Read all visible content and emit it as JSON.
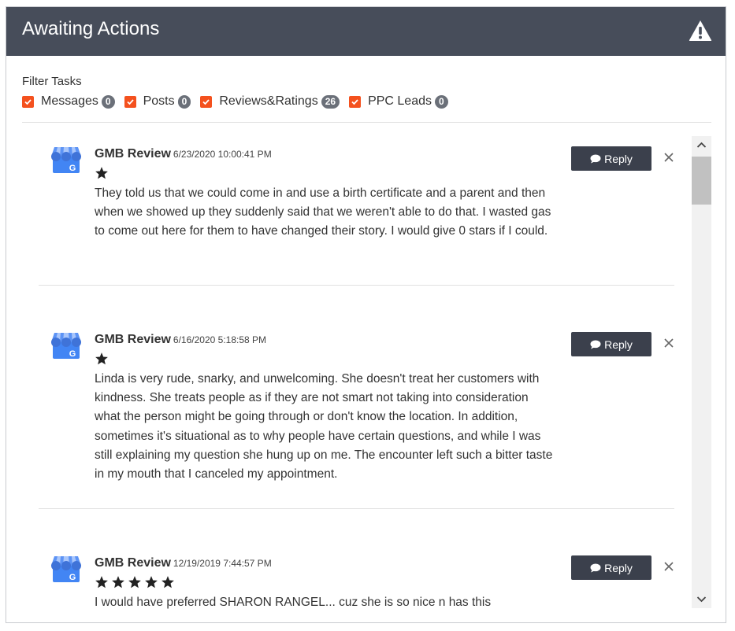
{
  "header": {
    "title": "Awaiting Actions",
    "icon": "warning-icon"
  },
  "filter": {
    "label": "Filter Tasks",
    "items": [
      {
        "label": "Messages",
        "count": "0",
        "checked": true
      },
      {
        "label": "Posts",
        "count": "0",
        "checked": true
      },
      {
        "label": "Reviews&Ratings",
        "count": "26",
        "checked": true
      },
      {
        "label": "PPC Leads",
        "count": "0",
        "checked": true
      }
    ]
  },
  "reviews": [
    {
      "source": "GMB Review",
      "date": "6/23/2020 10:00:41 PM",
      "rating": 1,
      "text": "They told us that we could come in and use a birth certificate and a parent and then when we showed up they suddenly said that we weren't able to do that. I wasted gas to come out here for them to have changed their story. I would give 0 stars if I could.",
      "reply_label": "Reply"
    },
    {
      "source": "GMB Review",
      "date": "6/16/2020 5:18:58 PM",
      "rating": 1,
      "text": "Linda is very rude, snarky, and unwelcoming. She doesn't treat her customers with kindness. She treats people as if they are not smart not taking into consideration what the person might be going through or don't know the location. In addition, sometimes it's situational as to why people have certain questions, and while I was still explaining my question she hung up on me. The encounter left such a bitter taste in my mouth that I canceled my appointment.",
      "reply_label": "Reply"
    },
    {
      "source": "GMB Review",
      "date": "12/19/2019 7:44:57 PM",
      "rating": 5,
      "text": "I would have preferred SHARON RANGEL... cuz she is so nice n has this",
      "reply_label": "Reply"
    }
  ],
  "colors": {
    "header_bg": "#474d5a",
    "accent": "#f4511e",
    "badge": "#6b7079",
    "button": "#3b404c"
  }
}
